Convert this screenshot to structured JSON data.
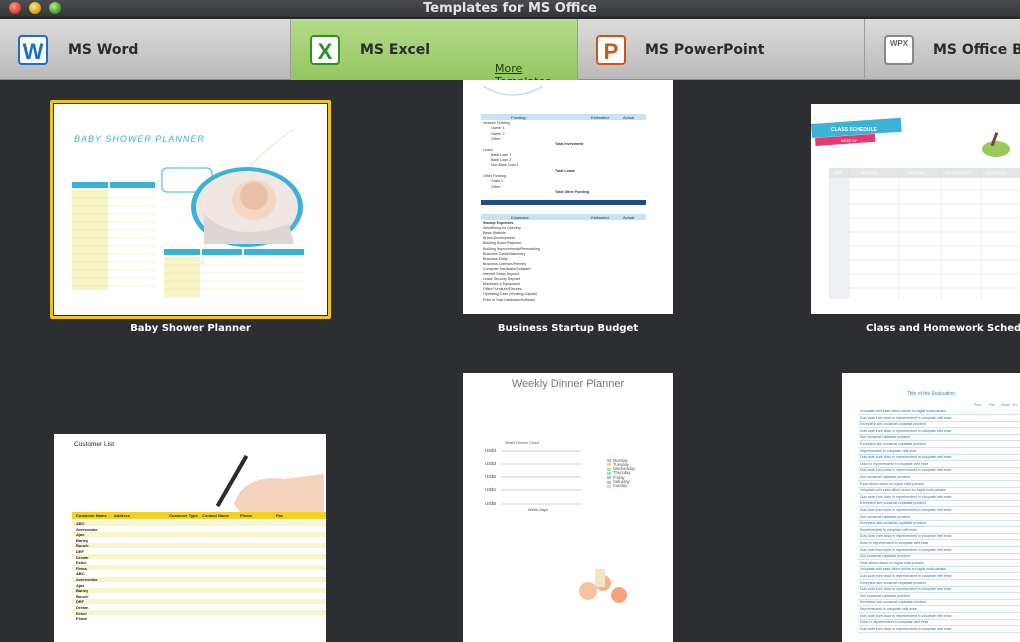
{
  "window": {
    "title": "Templates for MS Office"
  },
  "tabs": [
    {
      "label": "MS Word",
      "icon": "word-icon",
      "icon_letter": "W",
      "color": "#1e6fc5"
    },
    {
      "label": "MS Excel",
      "icon": "excel-icon",
      "icon_letter": "X",
      "color": "#2f8f2a",
      "active": true,
      "more_link": "More Templates"
    },
    {
      "label": "MS PowerPoint",
      "icon": "powerpoint-icon",
      "icon_letter": "P",
      "color": "#d2531a"
    },
    {
      "label": "MS Office Bun",
      "icon": "office-bundle-icon",
      "icon_letter": "WPX"
    }
  ],
  "templates": [
    {
      "name": "Baby Shower Planner",
      "selected": true,
      "content": {
        "heading": "BABY SHOWER PLANNER"
      }
    },
    {
      "name": "Business Startup Budget",
      "content": {
        "head1": [
          "Funding",
          "Estimated",
          "Actual"
        ],
        "rows1": [
          "Investor Funding",
          "Owner 1",
          "Owner 2",
          "Other",
          "Total Investment",
          "Loans",
          "Bank Loan 1",
          "Bank Loan 2",
          "Non Bank Loan 1",
          "Total Loans",
          "Other Funding",
          "Grant 1",
          "Other",
          "Total Other Funding",
          "Total Funding"
        ],
        "head2": [
          "Expenses",
          "Estimated",
          "Actual"
        ],
        "rows2": [
          "Startup Expenses",
          "Advertising for Opening",
          "Basic Website",
          "Brand Development",
          "Building Down Payment",
          "Building Improvements/Remodeling",
          "Business Cards/Stationery",
          "Business Entity",
          "Business Licenses/Permits",
          "Computer Hardware/Software",
          "Internet Setup Deposit",
          "Lease Security Deposit",
          "Machines & Equipment",
          "Office Furniture/Fixtures",
          "Operating Cash (Working Capital)",
          "Point of Sale Hardware/Software"
        ]
      }
    },
    {
      "name": "Class and Homework Schedul",
      "content": {
        "banner": "CLASS SCHEDULE",
        "sub": "WEEK OF",
        "days": [
          "TIME",
          "MONDAY",
          "TUESDAY",
          "WEDNESDAY",
          "THURSDAY"
        ]
      }
    },
    {
      "name": "",
      "content": {
        "heading": "Customer List",
        "columns": [
          "Customer Name",
          "Address",
          "Customer Type",
          "Contact Name",
          "Phone",
          "Fax"
        ],
        "customers": [
          "ABC",
          "Avercombe",
          "Ajax",
          "Barley",
          "Bunch",
          "DEF",
          "Dream",
          "Eckel",
          "Finna",
          "ABC",
          "Avercombe",
          "Ajax",
          "Barley",
          "Bunch",
          "DEF",
          "Dream",
          "Eckel",
          "Finna"
        ]
      }
    },
    {
      "name": "",
      "content": {
        "heading": "Weekly Dinner Planner",
        "chart_title": "Week Dinner Chart",
        "y_ticks": [
          "US$4",
          "US$3",
          "US$2",
          "US$1",
          "US$0"
        ],
        "x_label": "Week days",
        "legend": [
          "Monday",
          "Tuesday",
          "Wednesday",
          "Thursday",
          "Friday",
          "Saturday",
          "Sunday"
        ]
      }
    },
    {
      "name": "",
      "content": {
        "heading": "Title of the Evaluation",
        "columns": [
          "Poor",
          "Fair",
          "Good",
          "Ex"
        ],
        "rows": [
          "Voluptate velit esse cillum dolore eu fugiat nulla pariatur",
          "Duis aute irure dolor in reprehenderit in voluptate velit esse",
          "Excepteur sint occaecat cupidatat proident",
          "Duis aute irure dolor in reprehenderit in voluptate velit esse",
          "Sint occaecat cupidatat proident",
          "Excepteur sint occaecat cupidatat proident",
          "Reprehenderit in voluptate velit esse",
          "Duis aute irure dolor in reprehenderit in voluptate velit esse",
          "Dolor in reprehenderit in voluptate velit esse",
          "Duis aute irure dolor in reprehenderit in voluptate velit esse",
          "Sint occaecat cupidatat proident",
          "Esse cillum dolore eu fugiat nulla pariatur"
        ]
      }
    }
  ]
}
